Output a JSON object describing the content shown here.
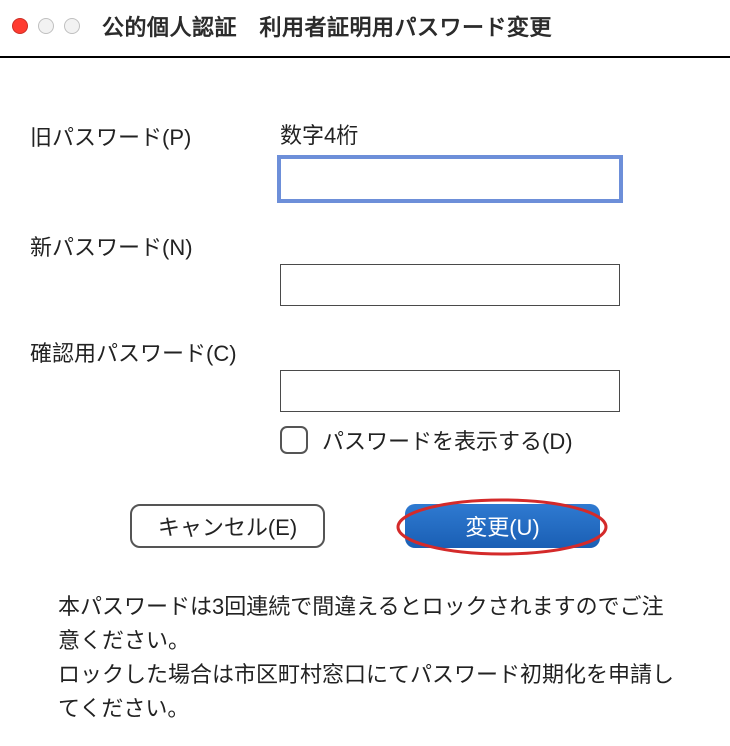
{
  "window": {
    "title": "公的個人認証　利用者証明用パスワード変更"
  },
  "form": {
    "old_password": {
      "label": "旧パスワード(P)",
      "hint": "数字4桁",
      "value": ""
    },
    "new_password": {
      "label": "新パスワード(N)",
      "value": ""
    },
    "confirm_password": {
      "label": "確認用パスワード(C)",
      "value": ""
    },
    "show_password": {
      "label": "パスワードを表示する(D)",
      "checked": false
    }
  },
  "buttons": {
    "cancel": "キャンセル(E)",
    "change": "変更(U)"
  },
  "notice": {
    "line1": "本パスワードは3回連続で間違えるとロックされますのでご注意ください。",
    "line2": "ロックした場合は市区町村窓口にてパスワード初期化を申請してください。"
  },
  "colors": {
    "accent": "#1a5fb4",
    "highlight": "#d42a2a"
  }
}
